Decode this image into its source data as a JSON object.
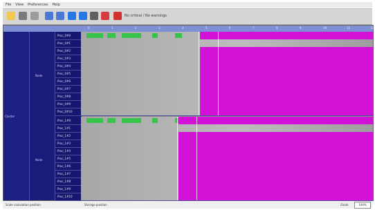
{
  "menu": [
    "File",
    "View",
    "Preferences",
    "Help"
  ],
  "toolbar": {
    "status_text": "No critical / No warnings"
  },
  "time_ticks": [
    "0",
    "1",
    "2",
    "3",
    "4",
    "5",
    "6",
    "7",
    "8",
    "9",
    "10",
    "11",
    "12"
  ],
  "left_labels": {
    "group": "Cluster",
    "subgroup_a": "Node",
    "subgroup_b": "Node"
  },
  "rows_a": [
    "Proc_0#0",
    "Proc_0#1",
    "Proc_0#2",
    "Proc_0#3",
    "Proc_0#4",
    "Proc_0#5",
    "Proc_0#6",
    "Proc_0#7",
    "Proc_0#8",
    "Proc_0#9",
    "Proc_0#10"
  ],
  "rows_b": [
    "Proc_1#0",
    "Proc_1#1",
    "Proc_1#2",
    "Proc_1#3",
    "Proc_1#4",
    "Proc_1#5",
    "Proc_1#6",
    "Proc_1#7",
    "Proc_1#8",
    "Proc_1#9",
    "Proc_1#10"
  ],
  "footer": {
    "left": "Scale calculation position",
    "mid": "Storage position",
    "zoom_label": "Zoom",
    "zoom_value": "100%"
  },
  "colors": {
    "accent": "#d212d6",
    "green": "#38c34a",
    "navy": "#1e1f82",
    "timebar": "#7f8fd3"
  }
}
